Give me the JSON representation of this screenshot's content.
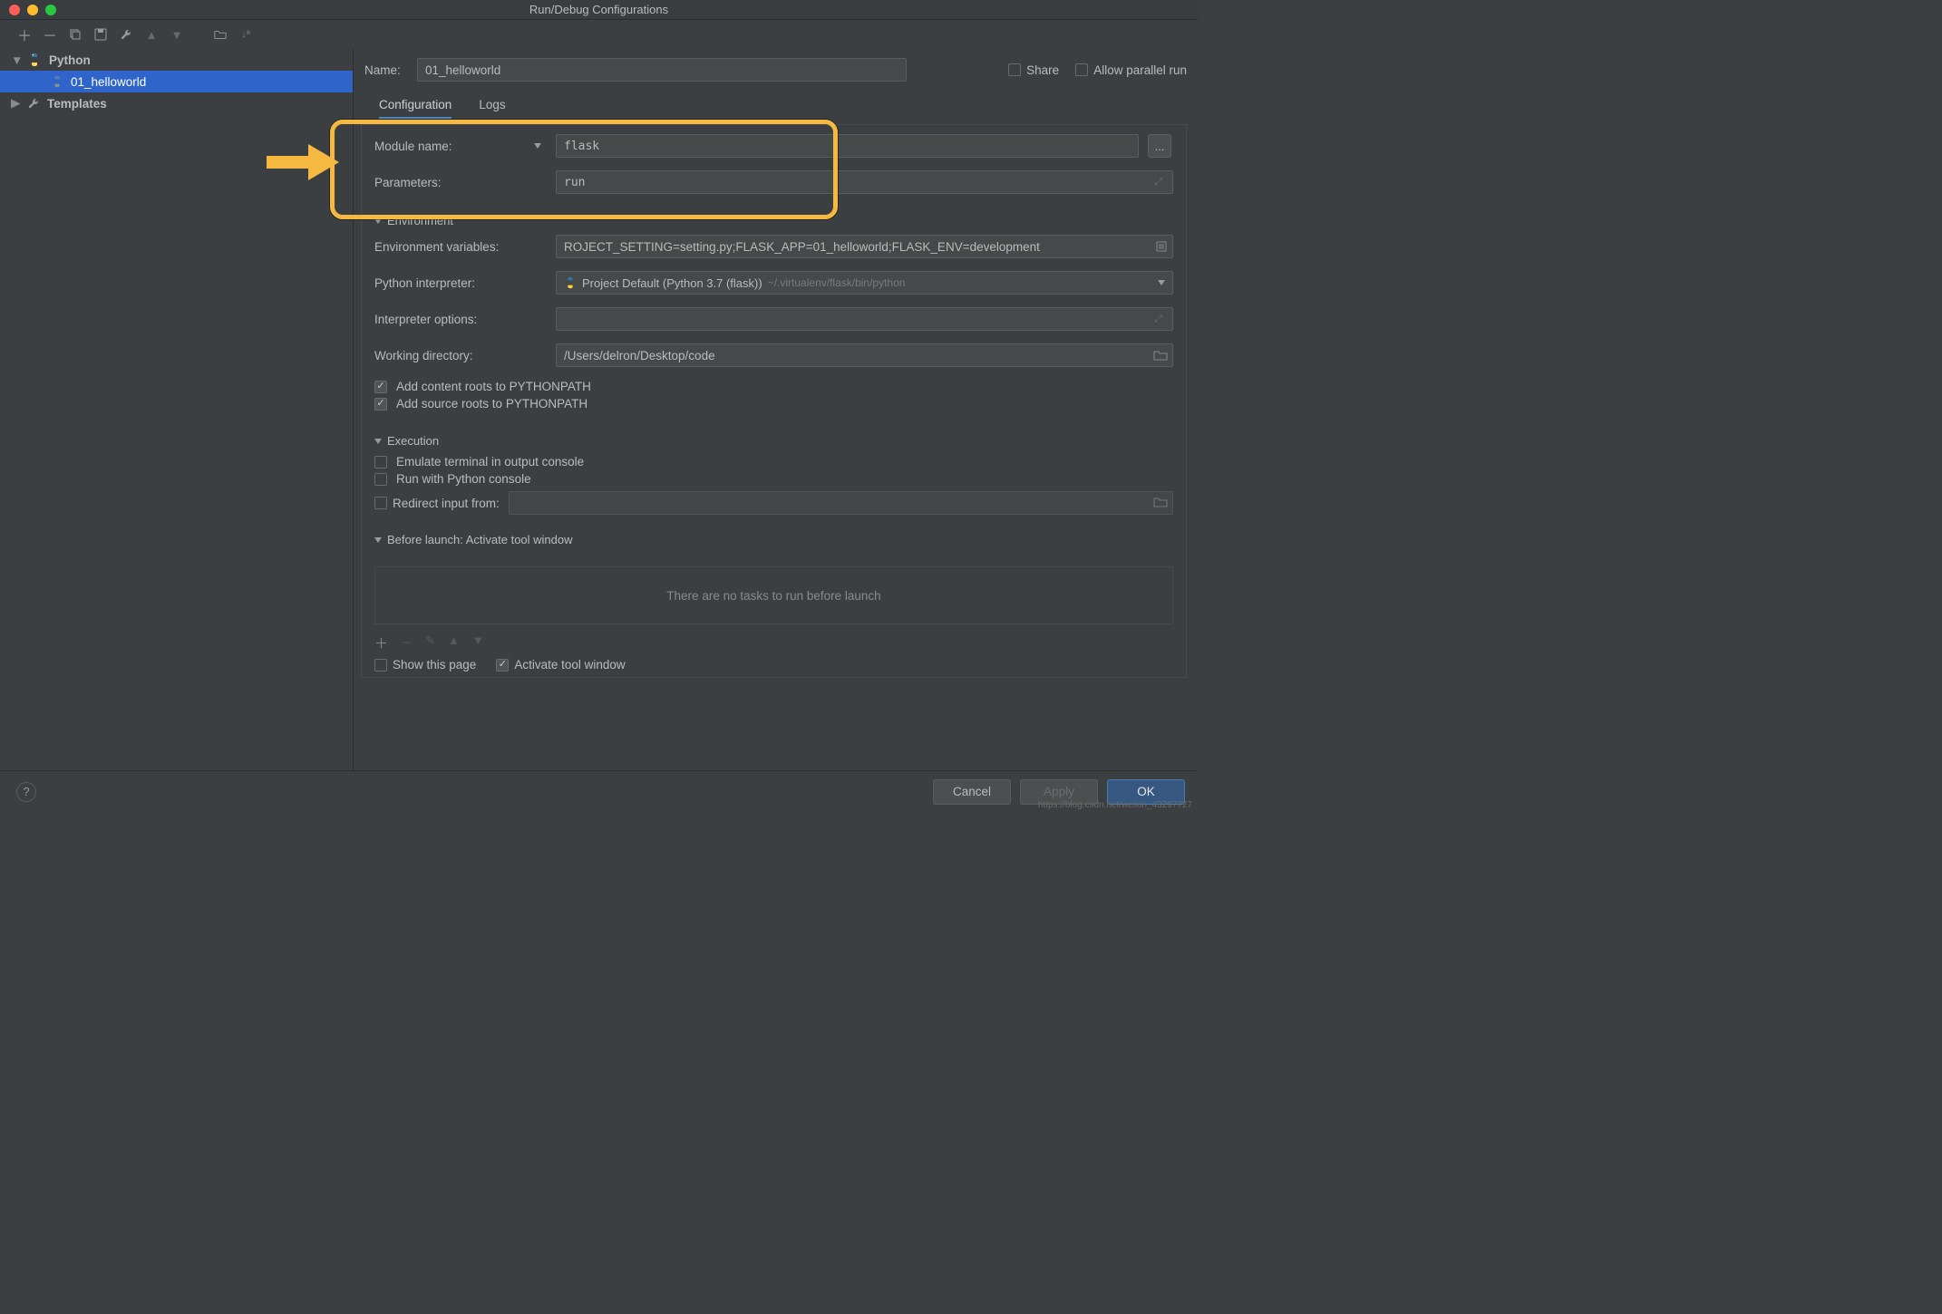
{
  "window": {
    "title": "Run/Debug Configurations"
  },
  "sidebar": {
    "nodes": [
      {
        "label": "Python",
        "depth": 0,
        "expanded": true
      },
      {
        "label": "01_helloworld",
        "depth": 1,
        "selected": true
      },
      {
        "label": "Templates",
        "depth": 0,
        "expanded": false
      }
    ]
  },
  "header": {
    "name_label": "Name:",
    "name_value": "01_helloworld",
    "share_label": "Share",
    "parallel_label": "Allow parallel run"
  },
  "tabs": {
    "configuration": "Configuration",
    "logs": "Logs"
  },
  "config": {
    "module_name_label": "Module name:",
    "module_name_value": "flask",
    "parameters_label": "Parameters:",
    "parameters_value": "run",
    "more_btn": "..."
  },
  "env": {
    "header": "Environment",
    "env_vars_label": "Environment variables:",
    "env_vars_value": "ROJECT_SETTING=setting.py;FLASK_APP=01_helloworld;FLASK_ENV=development",
    "interp_label": "Python interpreter:",
    "interp_main": "Project Default (Python 3.7 (flask))",
    "interp_sub": "~/.virtualenv/flask/bin/python",
    "interp_opts_label": "Interpreter options:",
    "interp_opts_value": "",
    "workdir_label": "Working directory:",
    "workdir_value": "/Users/delron/Desktop/code",
    "add_content_label": "Add content roots to PYTHONPATH",
    "add_source_label": "Add source roots to PYTHONPATH"
  },
  "exec": {
    "header": "Execution",
    "emulate_label": "Emulate terminal in output console",
    "run_console_label": "Run with Python console",
    "redirect_label": "Redirect input from:"
  },
  "before": {
    "header": "Before launch: Activate tool window",
    "empty": "There are no tasks to run before launch",
    "show_page": "Show this page",
    "activate": "Activate tool window"
  },
  "footer": {
    "cancel": "Cancel",
    "apply": "Apply",
    "ok": "OK"
  },
  "watermark": "https://blog.csdn.net/weixin_43297727"
}
